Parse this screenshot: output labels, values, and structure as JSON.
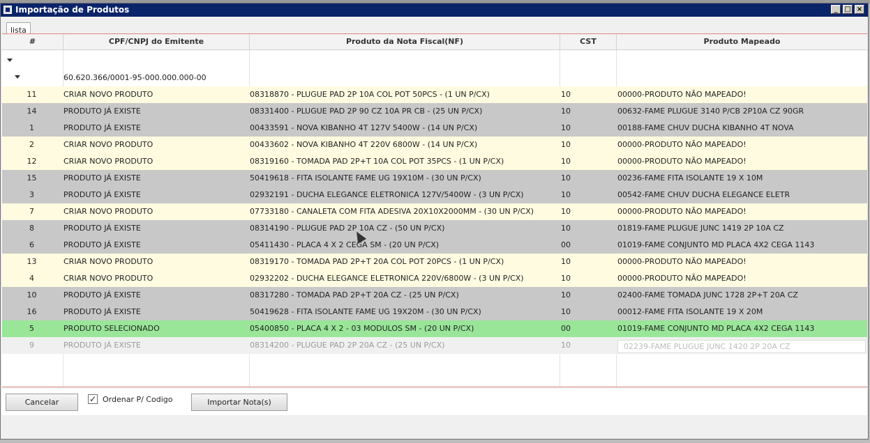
{
  "window": {
    "title": "Importação de Produtos"
  },
  "tabs": [
    {
      "label": "lista"
    }
  ],
  "table": {
    "columns": [
      "#",
      "CPF/CNPJ do Emitente",
      "Produto da Nota Fiscal(NF)",
      "CST",
      "Produto Mapeado"
    ],
    "group": "60.620.366/0001-95-000.000.000-00",
    "rows": [
      {
        "id": "11",
        "status": "CRIAR NOVO PRODUTO",
        "product": "08318870 - PLUGUE PAD 2P 10A COL POT 50PCS  - (1 UN P/CX)",
        "cst": "10",
        "mapped": "00000-PRODUTO NÃO MAPEADO!",
        "bg": "#fffbe0"
      },
      {
        "id": "14",
        "status": "PRODUTO JÁ EXISTE",
        "product": "08331400 - PLUGUE PAD 2P 90 CZ 10A PR CB  - (25 UN P/CX)",
        "cst": "10",
        "mapped": "00632-FAME PLUGUE 3140 P/CB 2P10A CZ 90GR",
        "bg": "#c8c8c8"
      },
      {
        "id": "1",
        "status": "PRODUTO JÁ EXISTE",
        "product": "00433591 - NOVA KIBANHO 4T 127V 5400W - (14 UN P/CX)",
        "cst": "10",
        "mapped": "00188-FAME CHUV DUCHA KIBANHO 4T NOVA",
        "bg": "#c8c8c8"
      },
      {
        "id": "2",
        "status": "CRIAR NOVO PRODUTO",
        "product": "00433602 - NOVA KIBANHO 4T 220V 6800W - (14 UN P/CX)",
        "cst": "10",
        "mapped": "00000-PRODUTO NÃO MAPEADO!",
        "bg": "#fffbe0"
      },
      {
        "id": "12",
        "status": "CRIAR NOVO PRODUTO",
        "product": "08319160 - TOMADA PAD 2P+T 10A COL POT 35PCS  - (1 UN P/CX)",
        "cst": "10",
        "mapped": "00000-PRODUTO NÃO MAPEADO!",
        "bg": "#fffbe0"
      },
      {
        "id": "15",
        "status": "PRODUTO JÁ EXISTE",
        "product": "50419618 - FITA ISOLANTE FAME UG 19X10M - (30 UN P/CX)",
        "cst": "10",
        "mapped": "00236-FAME FITA ISOLANTE 19 X 10M",
        "bg": "#c8c8c8"
      },
      {
        "id": "3",
        "status": "PRODUTO JÁ EXISTE",
        "product": "02932191 - DUCHA ELEGANCE ELETRONICA 127V/5400W - (3 UN P/CX)",
        "cst": "10",
        "mapped": "00542-FAME CHUV DUCHA ELEGANCE ELETR",
        "bg": "#c8c8c8"
      },
      {
        "id": "7",
        "status": "CRIAR NOVO PRODUTO",
        "product": "07733180 - CANALETA COM FITA ADESIVA 20X10X2000MM - (30 UN P/CX)",
        "cst": "10",
        "mapped": "00000-PRODUTO NÃO MAPEADO!",
        "bg": "#fffbe0"
      },
      {
        "id": "8",
        "status": "PRODUTO JÁ EXISTE",
        "product": "08314190 - PLUGUE PAD 2P 10A CZ  - (50 UN P/CX)",
        "cst": "10",
        "mapped": "01819-FAME PLUGUE JUNC 1419 2P 10A CZ",
        "bg": "#c8c8c8"
      },
      {
        "id": "6",
        "status": "PRODUTO JÁ EXISTE",
        "product": "05411430 - PLACA 4 X 2 CEGA SM  - (20 UN P/CX)",
        "cst": "00",
        "mapped": "01019-FAME CONJUNTO MD PLACA 4X2 CEGA 1143",
        "bg": "#c8c8c8"
      },
      {
        "id": "13",
        "status": "CRIAR NOVO PRODUTO",
        "product": "08319170 - TOMADA PAD 2P+T 20A COL POT 20PCS  - (1 UN P/CX)",
        "cst": "10",
        "mapped": "00000-PRODUTO NÃO MAPEADO!",
        "bg": "#fffbe0"
      },
      {
        "id": "4",
        "status": "CRIAR NOVO PRODUTO",
        "product": "02932202 - DUCHA ELEGANCE ELETRONICA 220V/6800W - (3 UN P/CX)",
        "cst": "10",
        "mapped": "00000-PRODUTO NÃO MAPEADO!",
        "bg": "#fffbe0"
      },
      {
        "id": "10",
        "status": "PRODUTO JÁ EXISTE",
        "product": "08317280 - TOMADA PAD 2P+T 20A CZ  - (25 UN P/CX)",
        "cst": "10",
        "mapped": "02400-FAME TOMADA JUNC 1728 2P+T 20A CZ",
        "bg": "#c8c8c8"
      },
      {
        "id": "16",
        "status": "PRODUTO JÁ EXISTE",
        "product": "50419628 - FITA ISOLANTE FAME UG 19X20M - (30 UN P/CX)",
        "cst": "10",
        "mapped": "00012-FAME FITA ISOLANTE 19 X 20M",
        "bg": "#c8c8c8"
      },
      {
        "id": "5",
        "status": "PRODUTO SELECIONADO",
        "product": "05400850 - PLACA 4 X 2 - 03 MODULOS SM  - (20 UN P/CX)",
        "cst": "00",
        "mapped": "01019-FAME CONJUNTO MD PLACA 4X2 CEGA 1143",
        "bg": "#99e699"
      }
    ],
    "editing_row": {
      "id": "9",
      "status": "PRODUTO JÁ EXISTE",
      "product": "08314200 - PLUGUE PAD 2P 20A CZ  - (25 UN P/CX)",
      "cst": "10",
      "mapped": "02239-FAME PLUGUE JUNC 1420 2P 20A CZ"
    }
  },
  "footer": {
    "cancel_label": "Cancelar",
    "sort_label": "Ordenar P/ Codigo",
    "sort_checked": true,
    "import_label": "Importar Nota(s)"
  },
  "colors": {
    "title_bar": "#0a246a",
    "row_new": "#fffbe0",
    "row_exists": "#c8c8c8",
    "row_selected": "#99e699",
    "panel_border": "#d98a7a"
  }
}
